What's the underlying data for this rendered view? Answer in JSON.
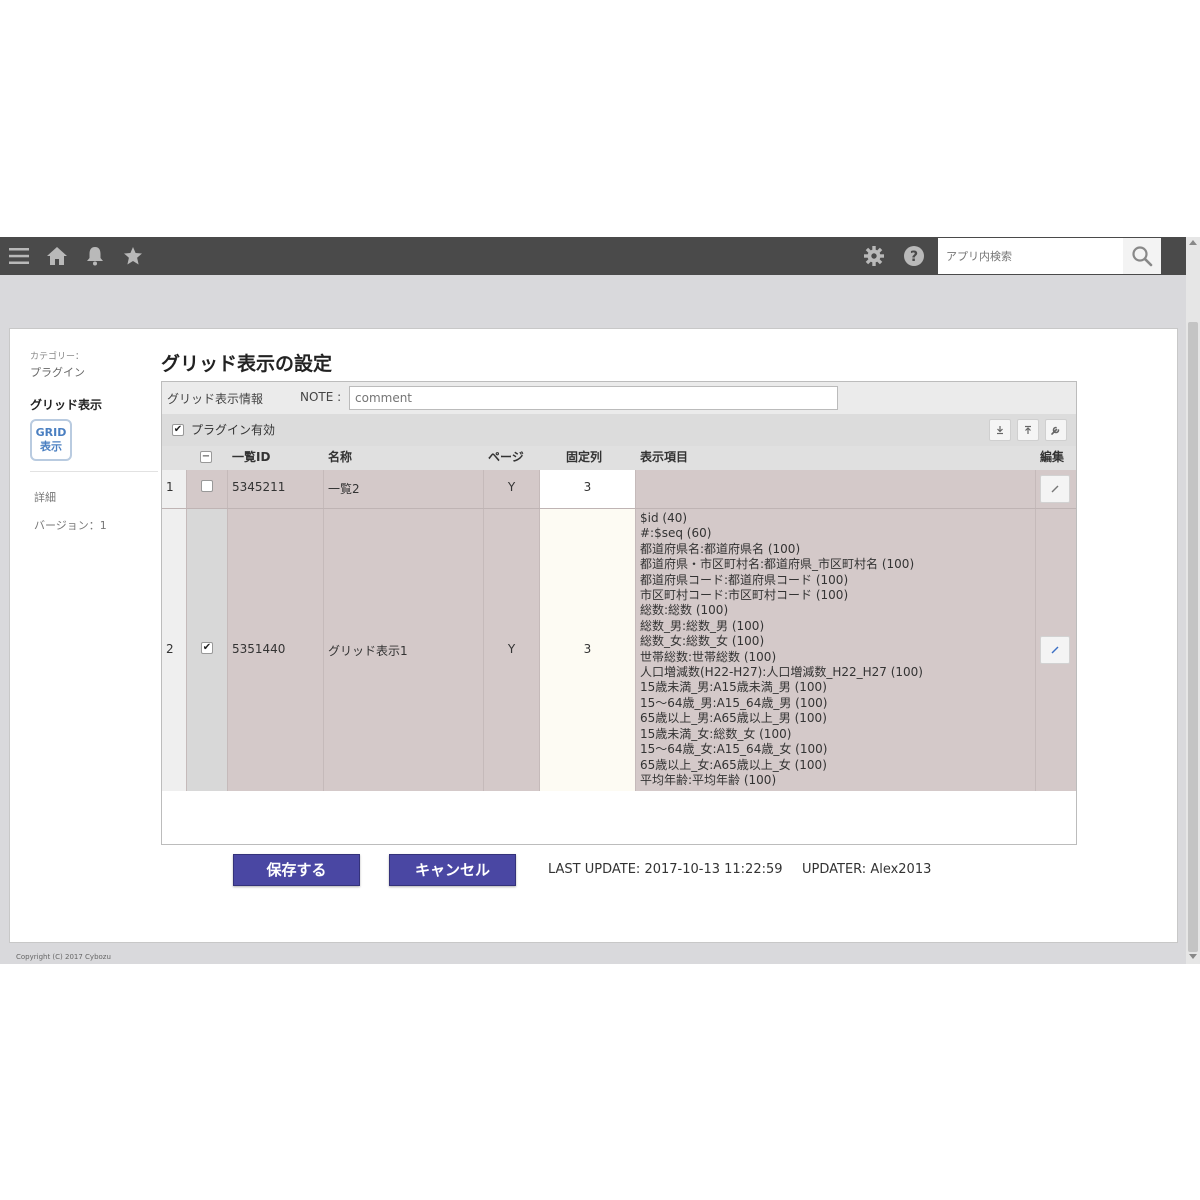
{
  "topbar": {
    "search_placeholder": "アプリ内検索",
    "icons": [
      "menu-icon",
      "home-icon",
      "bell-icon",
      "star-icon",
      "gear-icon",
      "help-icon",
      "search-icon"
    ]
  },
  "sidebar": {
    "category_label": "カテゴリー：",
    "category_value": "プラグイン",
    "plugin_name": "グリッド表示",
    "logo_line1": "GRID",
    "logo_line2": "表示",
    "links": [
      "詳細",
      "バージョン：1"
    ]
  },
  "main": {
    "title": "グリッド表示の設定",
    "info_label": "グリッド表示情報",
    "note_label": "NOTE :",
    "note_placeholder": "comment",
    "plugin_enabled_label": "プラグイン有効",
    "plugin_enabled": true,
    "table": {
      "headers": [
        "一覧ID",
        "名称",
        "ページ",
        "固定列",
        "表示項目",
        "編集"
      ],
      "rows": [
        {
          "num": "1",
          "checked": false,
          "id": "5345211",
          "name": "一覧2",
          "page": "Y",
          "fixed": "3",
          "items": []
        },
        {
          "num": "2",
          "checked": true,
          "id": "5351440",
          "name": "グリッド表示1",
          "page": "Y",
          "fixed": "3",
          "items": [
            "$id (40)",
            "#:$seq (60)",
            "都道府県名:都道府県名 (100)",
            "都道府県・市区町村名:都道府県_市区町村名 (100)",
            "都道府県コード:都道府県コード (100)",
            "市区町村コード:市区町村コード (100)",
            "総数:総数 (100)",
            "総数_男:総数_男 (100)",
            "総数_女:総数_女 (100)",
            "世帯総数:世帯総数 (100)",
            "人口増減数(H22-H27):人口増減数_H22_H27 (100)",
            "15歳未満_男:A15歳未満_男 (100)",
            "15～64歳_男:A15_64歳_男 (100)",
            "65歳以上_男:A65歳以上_男 (100)",
            "15歳未満_女:総数_女 (100)",
            "15～64歳_女:A15_64歳_女 (100)",
            "65歳以上_女:A65歳以上_女 (100)",
            "平均年齢:平均年齢 (100)"
          ]
        }
      ]
    }
  },
  "footer": {
    "save_label": "保存する",
    "cancel_label": "キャンセル",
    "last_update": "LAST UPDATE: 2017-10-13 11:22:59",
    "updater": "UPDATER: Alex2013",
    "copyright": "Copyright (C) 2017 Cybozu"
  }
}
